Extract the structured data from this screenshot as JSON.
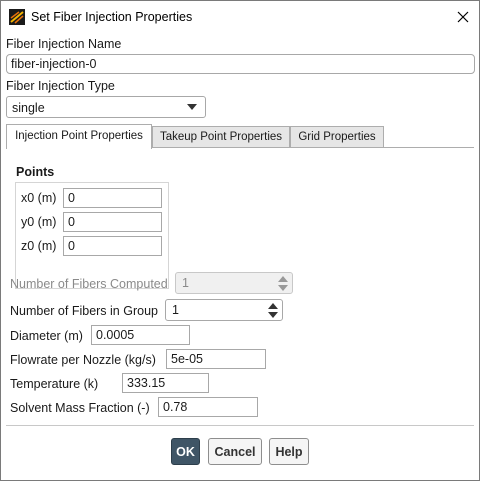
{
  "window": {
    "title": "Set Fiber Injection Properties"
  },
  "injection_name": {
    "label": "Fiber Injection Name",
    "value": "fiber-injection-0"
  },
  "injection_type": {
    "label": "Fiber Injection Type",
    "selected": "single"
  },
  "tabs": [
    {
      "label": "Injection Point Properties",
      "active": true
    },
    {
      "label": "Takeup Point Properties",
      "active": false
    },
    {
      "label": "Grid Properties",
      "active": false
    }
  ],
  "points": {
    "title": "Points",
    "x0": {
      "label": "x0 (m)",
      "value": "0"
    },
    "y0": {
      "label": "y0 (m)",
      "value": "0"
    },
    "z0": {
      "label": "z0 (m)",
      "value": "0"
    }
  },
  "fibers_computed": {
    "label": "Number of Fibers Computed",
    "value": "1",
    "disabled": true
  },
  "fibers_in_group": {
    "label": "Number of Fibers in Group",
    "value": "1"
  },
  "diameter": {
    "label": "Diameter (m)",
    "value": "0.0005"
  },
  "flowrate": {
    "label": "Flowrate per Nozzle (kg/s)",
    "value": "5e-05"
  },
  "temperature": {
    "label": "Temperature (k)",
    "value": "333.15"
  },
  "solvent_mass_fraction": {
    "label": "Solvent Mass Fraction (-)",
    "value": "0.78"
  },
  "buttons": {
    "ok": "OK",
    "cancel": "Cancel",
    "help": "Help"
  },
  "colors": {
    "primary_button": "#3f5566",
    "disabled_text": "#8a8a8a"
  }
}
